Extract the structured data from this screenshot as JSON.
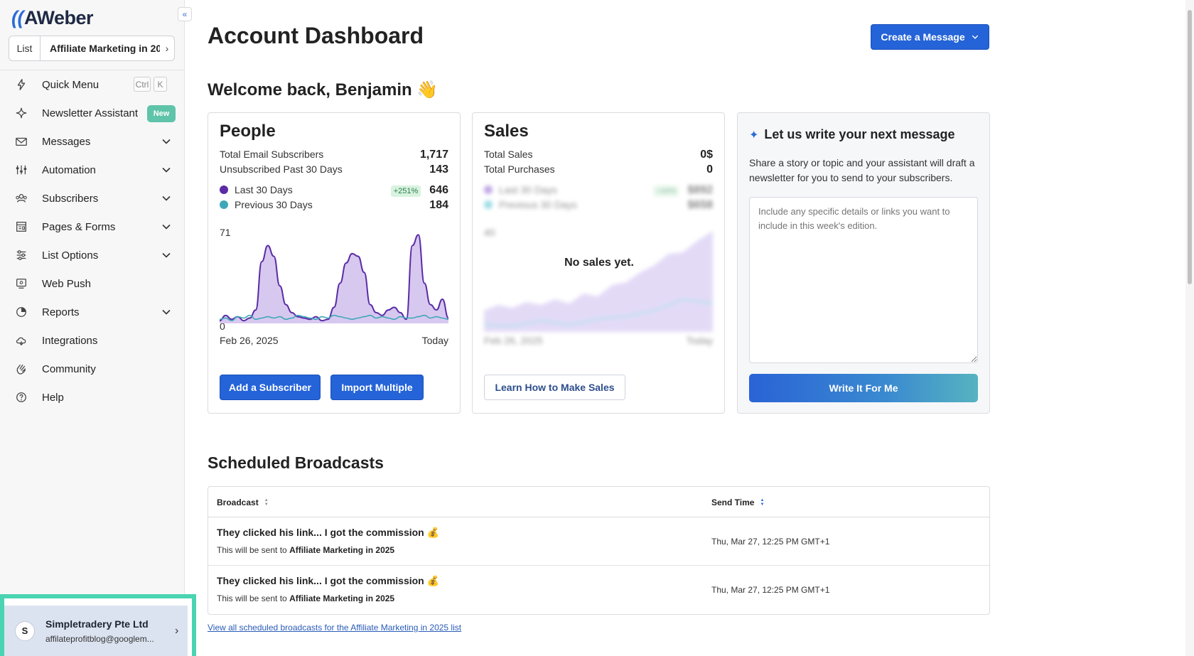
{
  "sidebar": {
    "logo_text": "AWeber",
    "logo_mark": "((",
    "collapse_icon": "«",
    "list_label": "List",
    "list_value": "Affiliate Marketing in 20",
    "items": [
      {
        "label": "Quick Menu",
        "icon": "bolt-icon",
        "kbd": [
          "Ctrl",
          "K"
        ]
      },
      {
        "label": "Newsletter Assistant",
        "icon": "sparkle-icon",
        "badge": "New"
      },
      {
        "label": "Messages",
        "icon": "envelope-icon",
        "expandable": true
      },
      {
        "label": "Automation",
        "icon": "automation-icon",
        "expandable": true
      },
      {
        "label": "Subscribers",
        "icon": "subscribers-icon",
        "expandable": true
      },
      {
        "label": "Pages & Forms",
        "icon": "pages-icon",
        "expandable": true
      },
      {
        "label": "List Options",
        "icon": "sliders-icon",
        "expandable": true
      },
      {
        "label": "Web Push",
        "icon": "web-push-icon"
      },
      {
        "label": "Reports",
        "icon": "reports-icon",
        "expandable": true
      },
      {
        "label": "Integrations",
        "icon": "cloud-icon"
      },
      {
        "label": "Community",
        "icon": "hand-icon"
      },
      {
        "label": "Help",
        "icon": "help-icon"
      }
    ],
    "account": {
      "initial": "S",
      "name": "Simpletradery Pte Ltd",
      "email": "affilateprofitblog@googlem..."
    }
  },
  "header": {
    "title": "Account Dashboard",
    "create_button": "Create a Message",
    "welcome": "Welcome back, Benjamin 👋"
  },
  "people": {
    "title": "People",
    "total_label": "Total Email Subscribers",
    "total_value": "1,717",
    "unsub_label": "Unsubscribed Past 30 Days",
    "unsub_value": "143",
    "last30_label": "Last 30 Days",
    "last30_badge": "+251%",
    "last30_value": "646",
    "prev30_label": "Previous 30 Days",
    "prev30_value": "184",
    "y_max_label": "71",
    "y_min_label": "0",
    "x_start_label": "Feb 26, 2025",
    "x_end_label": "Today",
    "add_button": "Add a Subscriber",
    "import_button": "Import Multiple",
    "colors": {
      "last30": "#5a2ca6",
      "last30_fill": "#d7c8ef",
      "prev30": "#3fa8b8"
    }
  },
  "sales": {
    "title": "Sales",
    "total_sales_label": "Total Sales",
    "total_sales_value": "0$",
    "total_purchases_label": "Total Purchases",
    "total_purchases_value": "0",
    "last30_label": "Last 30 Days",
    "last30_badge": "+34%",
    "last30_value": "$892",
    "prev30_label": "Previous 30 Days",
    "prev30_value": "$658",
    "y_max_label": "40",
    "x_start_label": "Feb 26, 2025",
    "x_end_label": "Today",
    "no_sales": "No sales yet.",
    "learn_button": "Learn How to Make Sales"
  },
  "assistant": {
    "title": "Let us write your next message",
    "description": "Share a story or topic and your assistant will draft a newsletter for you to send to your subscribers.",
    "placeholder": "Include any specific details or links you want to include in this week's edition.",
    "button": "Write It For Me"
  },
  "scheduled": {
    "title": "Scheduled Broadcasts",
    "columns": [
      "Broadcast",
      "Send Time"
    ],
    "rows": [
      {
        "title": "They clicked his link... I got the commission 💰",
        "sent_to_prefix": "This will be sent to",
        "list": "Affiliate Marketing in 2025",
        "time": "Thu, Mar 27, 12:25 PM GMT+1"
      },
      {
        "title": "They clicked his link... I got the commission 💰",
        "sent_to_prefix": "This will be sent to",
        "list": "Affiliate Marketing in 2025",
        "time": "Thu, Mar 27, 12:25 PM GMT+1"
      }
    ],
    "view_all": "View all scheduled broadcasts for the Affiliate Marketing in 2025 list"
  },
  "chart_data": {
    "type": "area",
    "title": "",
    "xlabel": "",
    "ylabel": "",
    "ylim": [
      0,
      71
    ],
    "x_range_labels": [
      "Feb 26, 2025",
      "Today"
    ],
    "series": [
      {
        "name": "Last 30 Days",
        "values": [
          2,
          6,
          3,
          5,
          2,
          4,
          10,
          46,
          58,
          50,
          28,
          14,
          8,
          5,
          4,
          3,
          5,
          2,
          3,
          12,
          30,
          45,
          52,
          50,
          38,
          14,
          8,
          6,
          10,
          12,
          8,
          3,
          58,
          66,
          30,
          14,
          10,
          18,
          4
        ]
      },
      {
        "name": "Previous 30 Days",
        "values": [
          3,
          4,
          2,
          5,
          4,
          6,
          3,
          4,
          5,
          4,
          5,
          3,
          4,
          6,
          5,
          4,
          3,
          5,
          4,
          6,
          5,
          4,
          3,
          4,
          5,
          6,
          4,
          5,
          4,
          3,
          5,
          4,
          4,
          5,
          6,
          4,
          5,
          4,
          3
        ]
      }
    ]
  }
}
